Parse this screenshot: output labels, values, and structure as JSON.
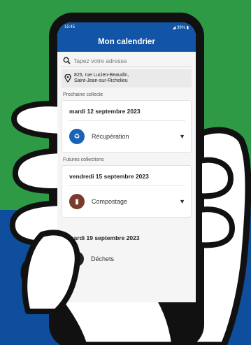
{
  "status_bar": {
    "time": "15:45",
    "battery": "◢ 39% ▮"
  },
  "app_bar": {
    "title": "Mon calendrier"
  },
  "search": {
    "placeholder": "Tapez votre adresse"
  },
  "address": {
    "line1": "825, rue Lucien-Beaudin,",
    "line2": "Saint-Jean-sur-Richelieu"
  },
  "next_collection": {
    "section_label": "Prochaine collecte",
    "date": "mardi 12 septembre 2023",
    "type": "Récupération",
    "icon": "recycle-icon",
    "icon_color": "#1a62b5"
  },
  "future_collections": {
    "section_label": "Futures collections",
    "items": [
      {
        "date": "vendredi 15 septembre 2023",
        "type": "Compostage",
        "icon": "compost-bin-icon",
        "icon_color": "#7a3b2e"
      },
      {
        "date": "mardi 19 septembre 2023",
        "type": "Déchets",
        "icon": "trash-icon",
        "icon_color": "#222222"
      }
    ]
  },
  "colors": {
    "brand_blue": "#1254a6",
    "background_green": "#2f9a46",
    "background_blue": "#0f4e9c"
  }
}
